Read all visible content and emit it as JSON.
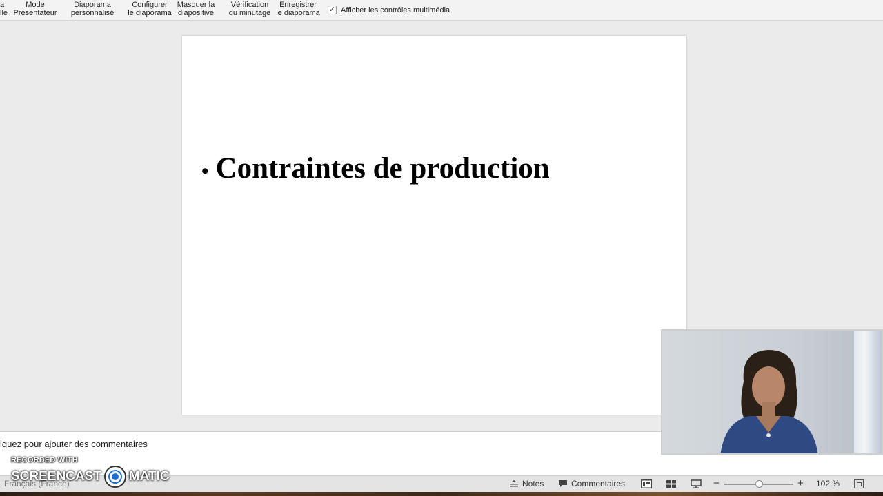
{
  "ribbon": {
    "partial_left": [
      "a",
      "lle"
    ],
    "buttons": [
      {
        "id": "presenter",
        "line1": "Mode",
        "line2": "Présentateur"
      },
      {
        "id": "custom-show",
        "line1": "Diaporama",
        "line2": "personnalisé"
      },
      {
        "id": "setup-show",
        "line1": "Configurer",
        "line2": "le diaporama"
      },
      {
        "id": "hide-slide",
        "line1": "Masquer la",
        "line2": "diapositive"
      },
      {
        "id": "rehearse",
        "line1": "Vérification",
        "line2": "du minutage"
      },
      {
        "id": "record",
        "line1": "Enregistrer",
        "line2": "le diaporama"
      }
    ],
    "media_controls": {
      "label": "Afficher les contrôles multimédia",
      "checked": true
    }
  },
  "slide": {
    "bullet_text": "Contraintes de production"
  },
  "notes": {
    "placeholder": "iquez pour ajouter des commentaires"
  },
  "statusbar": {
    "language": "Français (France)",
    "notes_label": "Notes",
    "comments_label": "Commentaires",
    "zoom_percent": "102 %",
    "zoom_value": 102
  },
  "watermark": {
    "top": "RECORDED WITH",
    "left": "SCREENCAST",
    "right": "MATIC"
  },
  "colors": {
    "app_background": "#ebebeb",
    "slide_background": "#ffffff",
    "watermark_blue": "#1f6fd1"
  },
  "icons": [
    "checkmark-icon",
    "notes-icon",
    "comments-icon",
    "normal-view-icon",
    "slide-sorter-icon",
    "slideshow-view-icon",
    "zoom-minus-icon",
    "zoom-plus-icon",
    "fit-to-window-icon",
    "screencast-logo-icon"
  ]
}
